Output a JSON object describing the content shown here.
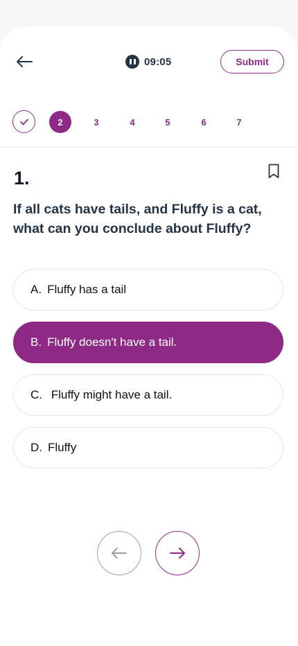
{
  "header": {
    "timer": "09:05",
    "submit_label": "Submit"
  },
  "stepper": {
    "steps": [
      {
        "label": "",
        "state": "done"
      },
      {
        "label": "2",
        "state": "current"
      },
      {
        "label": "3",
        "state": "upcoming"
      },
      {
        "label": "4",
        "state": "upcoming"
      },
      {
        "label": "5",
        "state": "upcoming"
      },
      {
        "label": "6",
        "state": "upcoming"
      },
      {
        "label": "7",
        "state": "upcoming"
      }
    ]
  },
  "question": {
    "number": "1.",
    "text": "If all cats have tails, and Fluffy is a cat, what can you conclude about Fluffy?",
    "selected": "B",
    "options": [
      {
        "letter": "A.",
        "text": "Fluffy has a tail"
      },
      {
        "letter": "B.",
        "text": "Fluffy doesn't have a tail."
      },
      {
        "letter": "C.",
        "text": " Fluffy might have a tail."
      },
      {
        "letter": "D.",
        "text": "Fluffy"
      }
    ]
  },
  "colors": {
    "accent": "#8e2a86",
    "text_dark": "#243447",
    "border_light": "#e6e6ea",
    "nav_gray": "#9aa0a8"
  },
  "icons": {
    "back": "arrow-left-icon",
    "pause": "pause-icon",
    "check": "check-icon",
    "bookmark": "bookmark-icon",
    "prev": "arrow-left-icon",
    "next": "arrow-right-icon"
  }
}
